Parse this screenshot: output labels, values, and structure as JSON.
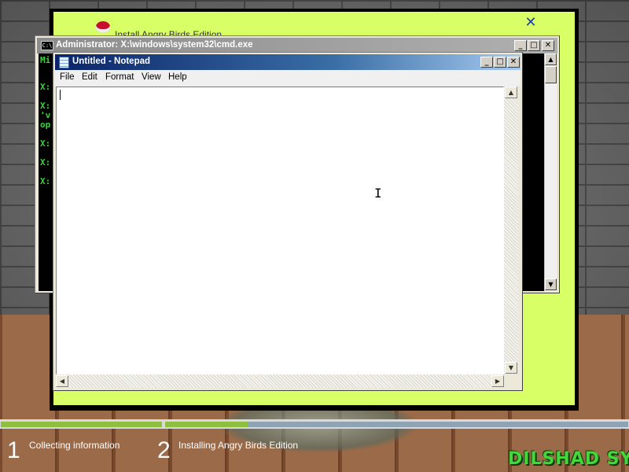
{
  "setup": {
    "title": "Install Angry Birds Edition",
    "close_glyph": "✕"
  },
  "cmd": {
    "title": "Administrator: X:\\windows\\system32\\cmd.exe",
    "icon_text": "C:\\",
    "lines": [
      "Mi",
      "X:",
      "X:",
      "'v",
      "op",
      "X:",
      "X:",
      "X:"
    ],
    "text_color": "#3ad13a"
  },
  "notepad": {
    "title": "Untitled - Notepad",
    "menu": [
      "File",
      "Edit",
      "Format",
      "View",
      "Help"
    ],
    "content": ""
  },
  "window_buttons": {
    "minimize": "_",
    "maximize": "□",
    "close": "✕"
  },
  "scroll_arrows": {
    "up": "▲",
    "down": "▼",
    "left": "◀",
    "right": "▶"
  },
  "progress": {
    "step1_complete": 1.0,
    "step2_fraction": 0.18,
    "complete_color": "#8fbf3f",
    "pending_color": "#8ea3b3"
  },
  "steps": [
    {
      "number": "1",
      "label": "Collecting information"
    },
    {
      "number": "2",
      "label": "Installing Angry Birds Edition"
    }
  ],
  "brand": "DILSHAD SYS",
  "cursor_glyph": "I"
}
